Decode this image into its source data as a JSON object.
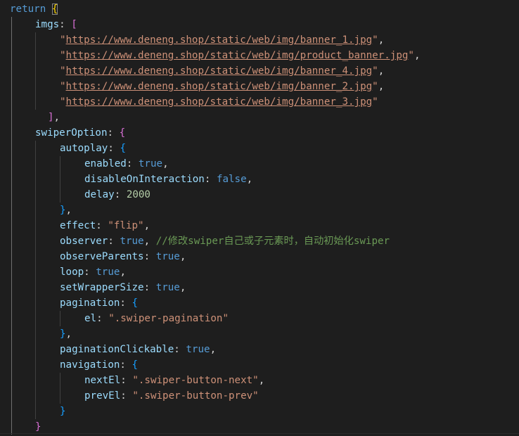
{
  "code": {
    "lines": [
      [
        {
          "t": "return",
          "c": "keyword"
        },
        {
          "t": " ",
          "c": "punct"
        },
        {
          "t": "{",
          "c": "brace-gold brace-match"
        }
      ],
      [
        {
          "t": "imgs",
          "c": "prop"
        },
        {
          "t": ": ",
          "c": "punct"
        },
        {
          "t": "[",
          "c": "brace-purple"
        }
      ],
      [
        {
          "t": "\"",
          "c": "string"
        },
        {
          "t": "https://www.deneng.shop/static/web/img/banner_1.jpg",
          "c": "link"
        },
        {
          "t": "\"",
          "c": "string"
        },
        {
          "t": ",",
          "c": "punct"
        }
      ],
      [
        {
          "t": "\"",
          "c": "string"
        },
        {
          "t": "https://www.deneng.shop/static/web/img/product_banner.jpg",
          "c": "link"
        },
        {
          "t": "\"",
          "c": "string"
        },
        {
          "t": ",",
          "c": "punct"
        }
      ],
      [
        {
          "t": "\"",
          "c": "string"
        },
        {
          "t": "https://www.deneng.shop/static/web/img/banner_4.jpg",
          "c": "link"
        },
        {
          "t": "\"",
          "c": "string"
        },
        {
          "t": ",",
          "c": "punct"
        }
      ],
      [
        {
          "t": "\"",
          "c": "string"
        },
        {
          "t": "https://www.deneng.shop/static/web/img/banner_2.jpg",
          "c": "link"
        },
        {
          "t": "\"",
          "c": "string"
        },
        {
          "t": ",",
          "c": "punct"
        }
      ],
      [
        {
          "t": "\"",
          "c": "string"
        },
        {
          "t": "https://www.deneng.shop/static/web/img/banner_3.jpg",
          "c": "link"
        },
        {
          "t": "\"",
          "c": "string"
        }
      ],
      [
        {
          "t": "]",
          "c": "brace-purple"
        },
        {
          "t": ",",
          "c": "punct"
        }
      ],
      [
        {
          "t": "swiperOption",
          "c": "prop"
        },
        {
          "t": ": ",
          "c": "punct"
        },
        {
          "t": "{",
          "c": "brace-purple"
        }
      ],
      [
        {
          "t": "autoplay",
          "c": "prop"
        },
        {
          "t": ": ",
          "c": "punct"
        },
        {
          "t": "{",
          "c": "brace-blue"
        }
      ],
      [
        {
          "t": "enabled",
          "c": "prop"
        },
        {
          "t": ": ",
          "c": "punct"
        },
        {
          "t": "true",
          "c": "bool"
        },
        {
          "t": ",",
          "c": "punct"
        }
      ],
      [
        {
          "t": "disableOnInteraction",
          "c": "prop"
        },
        {
          "t": ": ",
          "c": "punct"
        },
        {
          "t": "false",
          "c": "bool"
        },
        {
          "t": ",",
          "c": "punct"
        }
      ],
      [
        {
          "t": "delay",
          "c": "prop"
        },
        {
          "t": ": ",
          "c": "punct"
        },
        {
          "t": "2000",
          "c": "number"
        }
      ],
      [
        {
          "t": "}",
          "c": "brace-blue"
        },
        {
          "t": ",",
          "c": "punct"
        }
      ],
      [
        {
          "t": "effect",
          "c": "prop"
        },
        {
          "t": ": ",
          "c": "punct"
        },
        {
          "t": "\"flip\"",
          "c": "string"
        },
        {
          "t": ",",
          "c": "punct"
        }
      ],
      [
        {
          "t": "observer",
          "c": "prop"
        },
        {
          "t": ": ",
          "c": "punct"
        },
        {
          "t": "true",
          "c": "bool"
        },
        {
          "t": ", ",
          "c": "punct"
        },
        {
          "t": "//修改swiper自己或子元素时，自动初始化swiper",
          "c": "comment"
        }
      ],
      [
        {
          "t": "observeParents",
          "c": "prop"
        },
        {
          "t": ": ",
          "c": "punct"
        },
        {
          "t": "true",
          "c": "bool"
        },
        {
          "t": ",",
          "c": "punct"
        }
      ],
      [
        {
          "t": "loop",
          "c": "prop"
        },
        {
          "t": ": ",
          "c": "punct"
        },
        {
          "t": "true",
          "c": "bool"
        },
        {
          "t": ",",
          "c": "punct"
        }
      ],
      [
        {
          "t": "setWrapperSize",
          "c": "prop"
        },
        {
          "t": ": ",
          "c": "punct"
        },
        {
          "t": "true",
          "c": "bool"
        },
        {
          "t": ",",
          "c": "punct"
        }
      ],
      [
        {
          "t": "pagination",
          "c": "prop"
        },
        {
          "t": ": ",
          "c": "punct"
        },
        {
          "t": "{",
          "c": "brace-blue"
        }
      ],
      [
        {
          "t": "el",
          "c": "prop"
        },
        {
          "t": ": ",
          "c": "punct"
        },
        {
          "t": "\".swiper-pagination\"",
          "c": "string"
        }
      ],
      [
        {
          "t": "}",
          "c": "brace-blue"
        },
        {
          "t": ",",
          "c": "punct"
        }
      ],
      [
        {
          "t": "paginationClickable",
          "c": "prop"
        },
        {
          "t": ": ",
          "c": "punct"
        },
        {
          "t": "true",
          "c": "bool"
        },
        {
          "t": ",",
          "c": "punct"
        }
      ],
      [
        {
          "t": "navigation",
          "c": "prop"
        },
        {
          "t": ": ",
          "c": "punct"
        },
        {
          "t": "{",
          "c": "brace-blue"
        }
      ],
      [
        {
          "t": "nextEl",
          "c": "prop"
        },
        {
          "t": ": ",
          "c": "punct"
        },
        {
          "t": "\".swiper-button-next\"",
          "c": "string"
        },
        {
          "t": ",",
          "c": "punct"
        }
      ],
      [
        {
          "t": "prevEl",
          "c": "prop"
        },
        {
          "t": ": ",
          "c": "punct"
        },
        {
          "t": "\".swiper-button-prev\"",
          "c": "string"
        }
      ],
      [
        {
          "t": "}",
          "c": "brace-blue"
        }
      ],
      [
        {
          "t": "}",
          "c": "brace-purple"
        }
      ]
    ]
  },
  "theme": {
    "background": "#1e1e1e",
    "keyword": "#569cd6",
    "property": "#9cdcfe",
    "string": "#ce9178",
    "number": "#b5cea8",
    "comment": "#6a9955",
    "bracket_level_1": "#ffd700",
    "bracket_level_2": "#da70d6",
    "bracket_level_3": "#179fff"
  }
}
